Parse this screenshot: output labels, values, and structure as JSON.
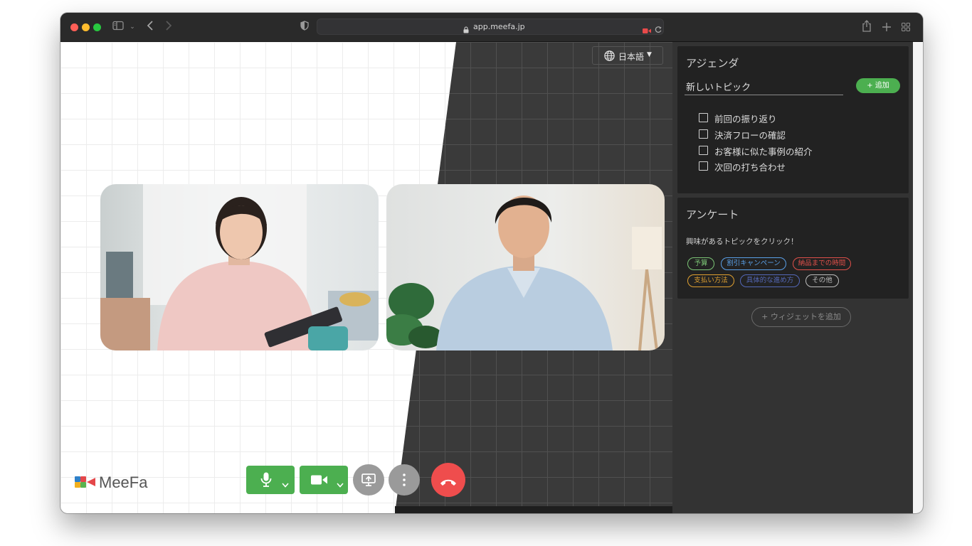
{
  "browser": {
    "url": "app.meefa.jp"
  },
  "header": {
    "language": "日本語"
  },
  "brand": {
    "name": "MeeFa"
  },
  "agenda": {
    "title": "アジェンダ",
    "input_value": "新しいトピック",
    "add_label": "+ 追加",
    "items": [
      {
        "label": "前回の振り返り",
        "checked": false
      },
      {
        "label": "決済フローの確認",
        "checked": false
      },
      {
        "label": "お客様に似た事例の紹介",
        "checked": false
      },
      {
        "label": "次回の打ち合わせ",
        "checked": false
      }
    ]
  },
  "survey": {
    "title": "アンケート",
    "prompt": "興味があるトピックをクリック！",
    "tags": [
      {
        "label": "予算",
        "color": "#7cc576"
      },
      {
        "label": "割引キャンペーン",
        "color": "#5aa0e8"
      },
      {
        "label": "納品までの時間",
        "color": "#e0504a"
      },
      {
        "label": "支払い方法",
        "color": "#e0a030"
      },
      {
        "label": "具体的な進め方",
        "color": "#5468b8"
      },
      {
        "label": "その他",
        "color": "#bdbdbd"
      }
    ]
  },
  "add_widget": {
    "label": "+ ウィジェットを追加"
  },
  "colors": {
    "accent_green": "#4caf50",
    "end_call_red": "#ef4d4d",
    "sidebar_bg": "#333333",
    "card_bg": "#222222"
  },
  "icons": {
    "mic": "microphone-icon",
    "camera": "video-camera-icon",
    "share": "screen-share-icon",
    "more": "more-vertical-icon",
    "end_call": "phone-hangup-icon",
    "language": "globe-icon"
  }
}
